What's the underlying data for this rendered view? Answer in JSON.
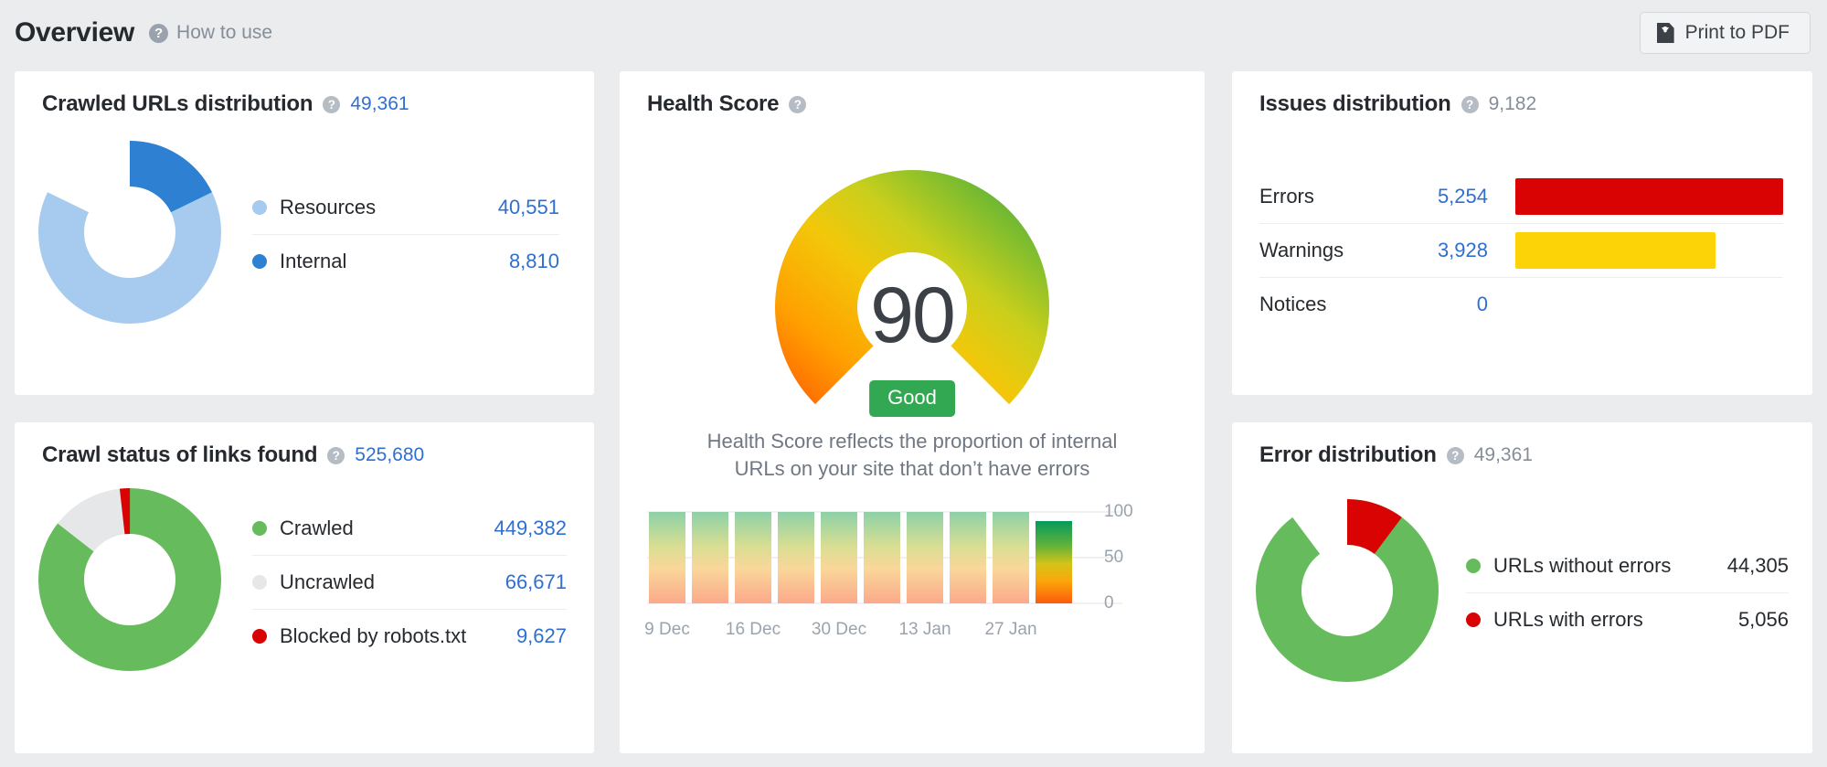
{
  "header": {
    "title": "Overview",
    "how_to_use": "How to use",
    "help_icon": "question-mark-icon",
    "print_button": {
      "label": "Print to PDF",
      "icon": "download-pdf-icon"
    }
  },
  "colors": {
    "background": "#ebecee",
    "card": "#ffffff",
    "link_blue": "#2f6fd0",
    "text_dark": "#262a2e",
    "text_muted": "#848e99",
    "resources_blue": "#a6cbee",
    "internal_blue": "#2e80d2",
    "green": "#66bb5c",
    "grey": "#e6e7e9",
    "red": "#da0303",
    "yellow": "#fcd307",
    "badge_green": "#33a852"
  },
  "cards": {
    "crawled_urls": {
      "title": "Crawled URLs distribution",
      "total": "49,361",
      "chart_data": {
        "type": "pie",
        "title": "Crawled URLs distribution",
        "categories": [
          "Resources",
          "Internal"
        ],
        "values": [
          40551,
          8810
        ],
        "labels": [
          "40,551",
          "8,810"
        ],
        "colors": [
          "#a6cbee",
          "#2e80d2"
        ],
        "total": 49361
      }
    },
    "crawl_status": {
      "title": "Crawl status of links found",
      "total": "525,680",
      "chart_data": {
        "type": "pie",
        "title": "Crawl status of links found",
        "categories": [
          "Crawled",
          "Uncrawled",
          "Blocked by robots.txt"
        ],
        "values": [
          449382,
          66671,
          9627
        ],
        "labels": [
          "449,382",
          "66,671",
          "9,627"
        ],
        "colors": [
          "#66bb5c",
          "#e6e7e9",
          "#da0303"
        ],
        "total": 525680
      }
    },
    "health_score": {
      "title": "Health Score",
      "value": "90",
      "badge": "Good",
      "description": "Health Score reflects the proportion of internal URLs on your site that don’t have errors",
      "chart_data": {
        "type": "bar",
        "title": "Health Score history",
        "categories": [
          "9 Dec",
          "",
          "16 Dec",
          "",
          "30 Dec",
          "",
          "13 Jan",
          "",
          "27 Jan",
          ""
        ],
        "tick_labels": [
          "9 Dec",
          "16 Dec",
          "30 Dec",
          "13 Jan",
          "27 Jan"
        ],
        "values": [
          100,
          100,
          100,
          100,
          100,
          100,
          100,
          100,
          100,
          90
        ],
        "highlight_index": 9,
        "ylim": [
          0,
          100
        ],
        "yticks": [
          0,
          50,
          100
        ],
        "ytick_labels": [
          "0",
          "50",
          "100"
        ],
        "grid": true,
        "gauge": {
          "type": "gauge",
          "value": 90,
          "min": 0,
          "max": 100,
          "label": "Good"
        }
      }
    },
    "issues_distribution": {
      "title": "Issues distribution",
      "total": "9,182",
      "chart_data": {
        "type": "bar",
        "orientation": "horizontal",
        "title": "Issues distribution",
        "categories": [
          "Errors",
          "Warnings",
          "Notices"
        ],
        "values": [
          5254,
          3928,
          0
        ],
        "labels": [
          "5,254",
          "3,928",
          "0"
        ],
        "colors": [
          "#da0303",
          "#fcd307",
          "#e6e7e9"
        ],
        "total": 9182
      }
    },
    "error_distribution": {
      "title": "Error distribution",
      "total": "49,361",
      "chart_data": {
        "type": "pie",
        "title": "Error distribution",
        "categories": [
          "URLs without errors",
          "URLs with errors"
        ],
        "values": [
          44305,
          5056
        ],
        "labels": [
          "44,305",
          "5,056"
        ],
        "colors": [
          "#66bb5c",
          "#da0303"
        ],
        "total": 49361
      }
    }
  }
}
